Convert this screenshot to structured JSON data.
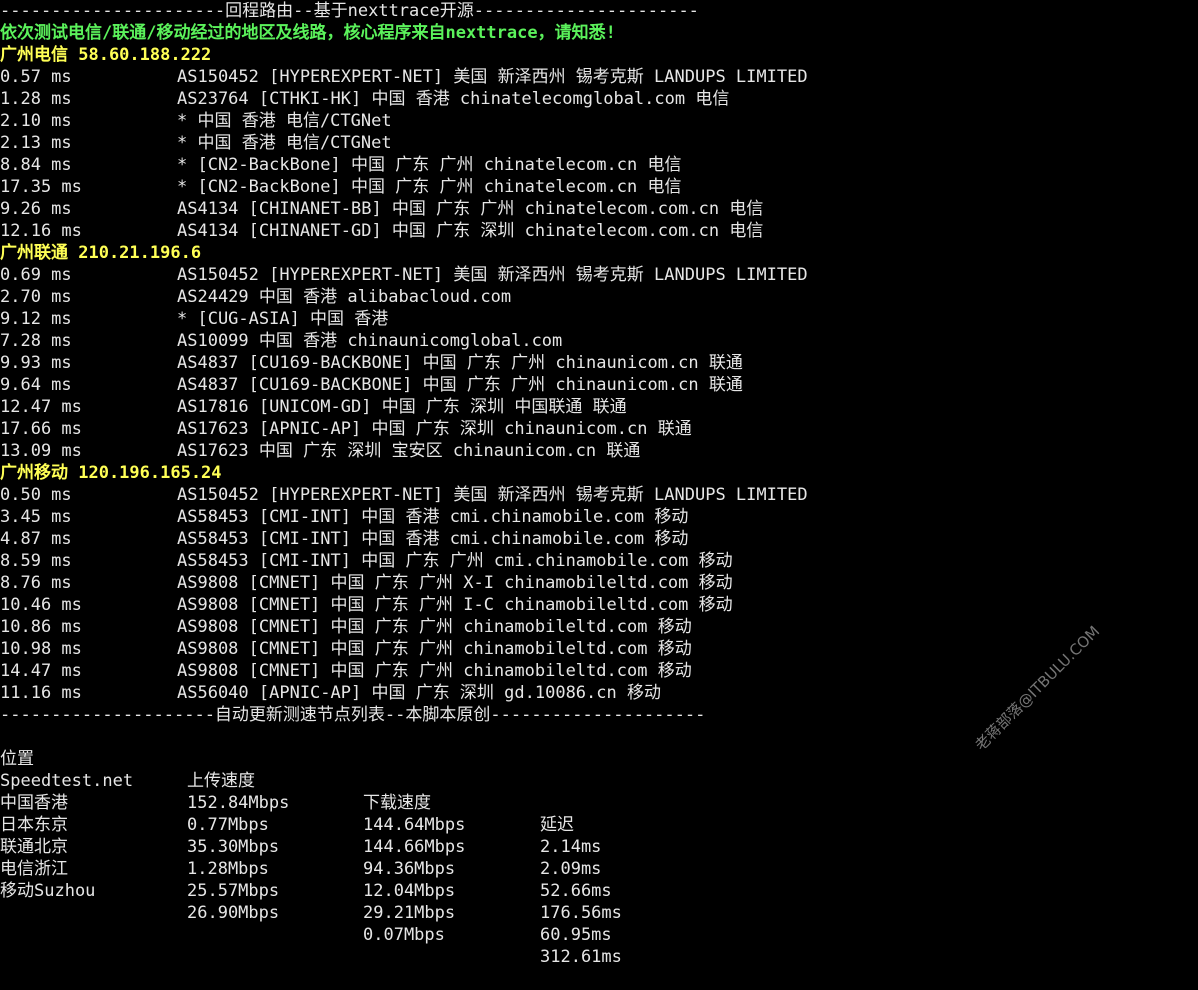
{
  "header_line": "----------------------回程路由--基于nexttrace开源----------------------",
  "notice": "依次测试电信/联通/移动经过的地区及线路，核心程序来自nexttrace，请知悉!",
  "groups": [
    {
      "title": "广州电信 58.60.188.222",
      "hops": [
        {
          "lat": "0.57 ms",
          "info": "AS150452 [HYPEREXPERT-NET] 美国 新泽西州 锡考克斯 LANDUPS LIMITED"
        },
        {
          "lat": "1.28 ms",
          "info": "AS23764 [CTHKI-HK] 中国 香港 chinatelecomglobal.com 电信"
        },
        {
          "lat": "2.10 ms",
          "info": "* 中国 香港 电信/CTGNet"
        },
        {
          "lat": "2.13 ms",
          "info": "* 中国 香港 电信/CTGNet"
        },
        {
          "lat": "8.84 ms",
          "info": "* [CN2-BackBone] 中国 广东 广州 chinatelecom.cn 电信"
        },
        {
          "lat": "17.35 ms",
          "info": "* [CN2-BackBone] 中国 广东 广州 chinatelecom.cn 电信"
        },
        {
          "lat": "9.26 ms",
          "info": "AS4134 [CHINANET-BB] 中国 广东 广州 chinatelecom.com.cn 电信"
        },
        {
          "lat": "12.16 ms",
          "info": "AS4134 [CHINANET-GD] 中国 广东 深圳 chinatelecom.com.cn 电信"
        }
      ]
    },
    {
      "title": "广州联通 210.21.196.6",
      "hops": [
        {
          "lat": "0.69 ms",
          "info": "AS150452 [HYPEREXPERT-NET] 美国 新泽西州 锡考克斯 LANDUPS LIMITED"
        },
        {
          "lat": "2.70 ms",
          "info": "AS24429 中国 香港 alibabacloud.com"
        },
        {
          "lat": "9.12 ms",
          "info": "* [CUG-ASIA] 中国 香港"
        },
        {
          "lat": "7.28 ms",
          "info": "AS10099 中国 香港 chinaunicomglobal.com"
        },
        {
          "lat": "9.93 ms",
          "info": "AS4837 [CU169-BACKBONE] 中国 广东 广州 chinaunicom.cn 联通"
        },
        {
          "lat": "9.64 ms",
          "info": "AS4837 [CU169-BACKBONE] 中国 广东 广州 chinaunicom.cn 联通"
        },
        {
          "lat": "12.47 ms",
          "info": "AS17816 [UNICOM-GD] 中国 广东 深圳 中国联通 联通"
        },
        {
          "lat": "17.66 ms",
          "info": "AS17623 [APNIC-AP] 中国 广东 深圳 chinaunicom.cn 联通"
        },
        {
          "lat": "13.09 ms",
          "info": "AS17623 中国 广东 深圳 宝安区 chinaunicom.cn 联通"
        }
      ]
    },
    {
      "title": "广州移动 120.196.165.24",
      "hops": [
        {
          "lat": "0.50 ms",
          "info": "AS150452 [HYPEREXPERT-NET] 美国 新泽西州 锡考克斯 LANDUPS LIMITED"
        },
        {
          "lat": "3.45 ms",
          "info": "AS58453 [CMI-INT] 中国 香港 cmi.chinamobile.com 移动"
        },
        {
          "lat": "4.87 ms",
          "info": "AS58453 [CMI-INT] 中国 香港 cmi.chinamobile.com 移动"
        },
        {
          "lat": "8.59 ms",
          "info": "AS58453 [CMI-INT] 中国 广东 广州 cmi.chinamobile.com 移动"
        },
        {
          "lat": "8.76 ms",
          "info": "AS9808 [CMNET] 中国 广东 广州 X-I chinamobileltd.com 移动"
        },
        {
          "lat": "10.46 ms",
          "info": "AS9808 [CMNET] 中国 广东 广州 I-C chinamobileltd.com 移动"
        },
        {
          "lat": "10.86 ms",
          "info": "AS9808 [CMNET] 中国 广东 广州 chinamobileltd.com 移动"
        },
        {
          "lat": "10.98 ms",
          "info": "AS9808 [CMNET] 中国 广东 广州 chinamobileltd.com 移动"
        },
        {
          "lat": "14.47 ms",
          "info": "AS9808 [CMNET] 中国 广东 广州 chinamobileltd.com 移动"
        },
        {
          "lat": "11.16 ms",
          "info": "AS56040 [APNIC-AP] 中国 广东 深圳 gd.10086.cn 移动"
        }
      ]
    }
  ],
  "speedtest_header": "---------------------自动更新测速节点列表--本脚本原创---------------------",
  "speedtest": {
    "columns": [
      "位置",
      "上传速度",
      "下载速度",
      "延迟"
    ],
    "rows": [
      [
        "Speedtest.net",
        "152.84Mbps",
        "144.64Mbps",
        "2.14ms"
      ],
      [
        "中国香港",
        "0.77Mbps",
        "144.66Mbps",
        "2.09ms"
      ],
      [
        "日本东京",
        "35.30Mbps",
        "94.36Mbps",
        "52.66ms"
      ],
      [
        "联通北京",
        "1.28Mbps",
        "12.04Mbps",
        "176.56ms"
      ],
      [
        "电信浙江",
        "25.57Mbps",
        "29.21Mbps",
        "60.95ms"
      ],
      [
        "移动Suzhou",
        "26.90Mbps",
        "0.07Mbps",
        "312.61ms"
      ]
    ]
  },
  "watermark": "老蒋部落@ITBULU.COM",
  "colors": {
    "background": "#000000",
    "text": "#e6e6e6",
    "notice": "#5bf25b",
    "group_title": "#ffff55"
  }
}
